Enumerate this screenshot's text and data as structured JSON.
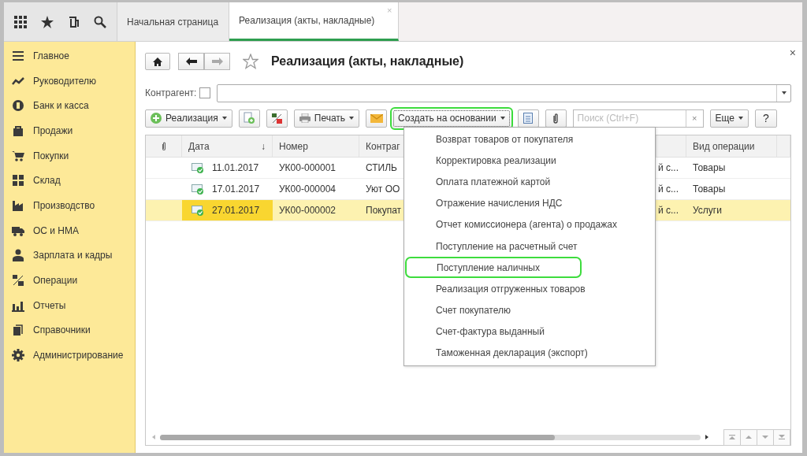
{
  "top_bar": {
    "tabs": [
      {
        "label": "Начальная страница",
        "selected": false
      },
      {
        "label": "Реализация (акты, накладные)",
        "selected": true,
        "close": "×"
      }
    ]
  },
  "sidebar": {
    "items": [
      {
        "label": "Главное"
      },
      {
        "label": "Руководителю"
      },
      {
        "label": "Банк и касса"
      },
      {
        "label": "Продажи"
      },
      {
        "label": "Покупки"
      },
      {
        "label": "Склад"
      },
      {
        "label": "Производство"
      },
      {
        "label": "ОС и НМА"
      },
      {
        "label": "Зарплата и кадры"
      },
      {
        "label": "Операции"
      },
      {
        "label": "Отчеты"
      },
      {
        "label": "Справочники"
      },
      {
        "label": "Администрирование"
      }
    ]
  },
  "form": {
    "title": "Реализация (акты, накладные)",
    "close": "×",
    "filter": {
      "label": "Контрагент:",
      "checked": false
    },
    "toolbar": [
      {
        "kind": "menu",
        "label": "Реализация",
        "highlighted": false
      },
      {
        "kind": "icon",
        "highlighted": false
      },
      {
        "kind": "icon",
        "highlighted": false
      },
      {
        "kind": "menu",
        "label": "Печать",
        "highlighted": false
      },
      {
        "kind": "icon",
        "highlighted": false
      },
      {
        "kind": "menu",
        "label": "Создать на основании",
        "highlighted": true,
        "menu_items": [
          {
            "label": "Возврат товаров от покупателя",
            "highlighted": false
          },
          {
            "label": "Корректировка реализации",
            "highlighted": false
          },
          {
            "label": "Оплата платежной картой",
            "highlighted": false
          },
          {
            "label": "Отражение начисления НДС",
            "highlighted": false
          },
          {
            "label": "Отчет комиссионера (агента) о продажах",
            "highlighted": false
          },
          {
            "label": "Поступление на расчетный счет",
            "highlighted": false
          },
          {
            "label": "Поступление наличных",
            "highlighted": true
          },
          {
            "label": "Реализация отгруженных товаров",
            "highlighted": false
          },
          {
            "label": "Счет покупателю",
            "highlighted": false
          },
          {
            "label": "Счет-фактура выданный",
            "highlighted": false
          },
          {
            "label": "Таможенная декларация (экспорт)",
            "highlighted": false
          }
        ]
      },
      {
        "kind": "icon",
        "highlighted": false
      },
      {
        "kind": "icon",
        "highlighted": false
      },
      {
        "kind": "search",
        "placeholder": "Поиск (Ctrl+F)",
        "clear": "×",
        "highlighted": false
      },
      {
        "kind": "menu",
        "label": "Еще",
        "highlighted": false
      },
      {
        "kind": "text",
        "label": "?",
        "highlighted": false
      }
    ],
    "table": {
      "columns": [
        {
          "label": "Дата",
          "sort": "↓"
        },
        {
          "label": "Номер"
        },
        {
          "label": "Контраг"
        },
        {
          "label": "Вид операции"
        }
      ],
      "rows": [
        {
          "date": "11.01.2017",
          "number": "УК00-000001",
          "column_4": "СТИЛЬ",
          "column_5": "й с...",
          "operation": "Товары",
          "posted": true,
          "selected": false
        },
        {
          "date": "17.01.2017",
          "number": "УК00-000004",
          "column_4": "Уют ОО",
          "column_5": "й с...",
          "operation": "Товары",
          "posted": true,
          "selected": false
        },
        {
          "date": "27.01.2017",
          "number": "УК00-000002",
          "column_4": "Покупат",
          "column_5": "й с...",
          "operation": "Услуги",
          "posted": true,
          "selected": true
        }
      ]
    }
  }
}
